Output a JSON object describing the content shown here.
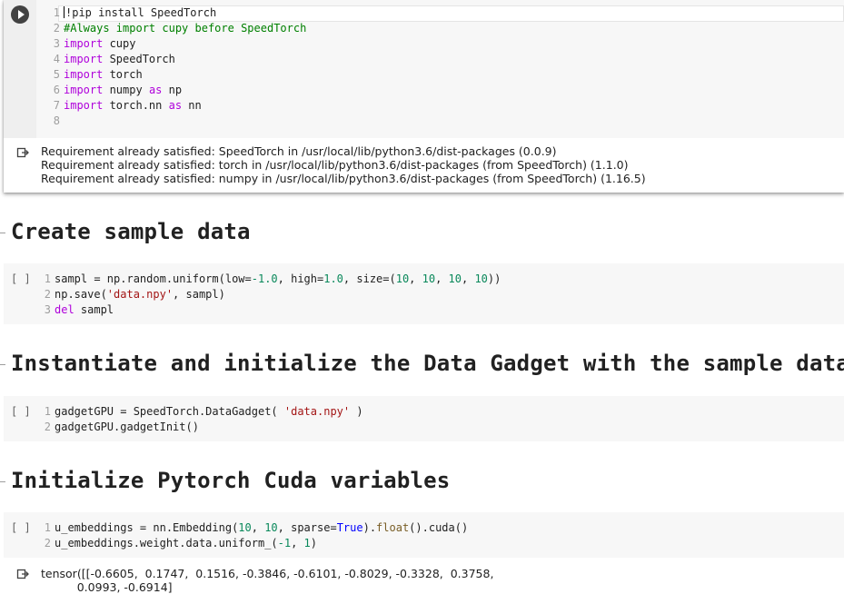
{
  "cell1": {
    "code": [
      {
        "ln": "1",
        "parts": [
          {
            "t": "!pip install SpeedTorch",
            "c": ""
          }
        ]
      },
      {
        "ln": "2",
        "parts": [
          {
            "t": "#Always import cupy before SpeedTorch",
            "c": "cmt"
          }
        ]
      },
      {
        "ln": "3",
        "parts": [
          {
            "t": "import",
            "c": "kw"
          },
          {
            "t": " cupy",
            "c": ""
          }
        ]
      },
      {
        "ln": "4",
        "parts": [
          {
            "t": "import",
            "c": "kw"
          },
          {
            "t": " SpeedTorch",
            "c": ""
          }
        ]
      },
      {
        "ln": "5",
        "parts": [
          {
            "t": "import",
            "c": "kw"
          },
          {
            "t": " torch",
            "c": ""
          }
        ]
      },
      {
        "ln": "6",
        "parts": [
          {
            "t": "import",
            "c": "kw"
          },
          {
            "t": " numpy ",
            "c": ""
          },
          {
            "t": "as",
            "c": "kw"
          },
          {
            "t": " np",
            "c": ""
          }
        ]
      },
      {
        "ln": "7",
        "parts": [
          {
            "t": "import",
            "c": "kw"
          },
          {
            "t": " torch.nn ",
            "c": ""
          },
          {
            "t": "as",
            "c": "kw"
          },
          {
            "t": " nn",
            "c": ""
          }
        ]
      },
      {
        "ln": "8",
        "parts": []
      }
    ],
    "output": [
      "Requirement already satisfied: SpeedTorch in /usr/local/lib/python3.6/dist-packages (0.0.9)",
      "Requirement already satisfied: torch in /usr/local/lib/python3.6/dist-packages (from SpeedTorch) (1.1.0)",
      "Requirement already satisfied: numpy in /usr/local/lib/python3.6/dist-packages (from SpeedTorch) (1.16.5)"
    ]
  },
  "headings": {
    "h1": "Create sample data",
    "h2": "Instantiate and initialize the Data Gadget with the sample data",
    "h3": "Initialize Pytorch Cuda variables"
  },
  "exec_count_label": "[ ]",
  "cell2": {
    "code": [
      {
        "ln": "1",
        "parts": [
          {
            "t": "sampl = np.random.uniform(low=",
            "c": ""
          },
          {
            "t": "-1.0",
            "c": "num"
          },
          {
            "t": ", high=",
            "c": ""
          },
          {
            "t": "1.0",
            "c": "num"
          },
          {
            "t": ", size=(",
            "c": ""
          },
          {
            "t": "10",
            "c": "num"
          },
          {
            "t": ", ",
            "c": ""
          },
          {
            "t": "10",
            "c": "num"
          },
          {
            "t": ", ",
            "c": ""
          },
          {
            "t": "10",
            "c": "num"
          },
          {
            "t": ", ",
            "c": ""
          },
          {
            "t": "10",
            "c": "num"
          },
          {
            "t": "))",
            "c": ""
          }
        ]
      },
      {
        "ln": "2",
        "parts": [
          {
            "t": "np.save(",
            "c": ""
          },
          {
            "t": "'data.npy'",
            "c": "str"
          },
          {
            "t": ", sampl)",
            "c": ""
          }
        ]
      },
      {
        "ln": "3",
        "parts": [
          {
            "t": "del",
            "c": "kw"
          },
          {
            "t": " sampl",
            "c": ""
          }
        ]
      }
    ]
  },
  "cell3": {
    "code": [
      {
        "ln": "1",
        "parts": [
          {
            "t": "gadgetGPU = SpeedTorch.DataGadget( ",
            "c": ""
          },
          {
            "t": "'data.npy'",
            "c": "str"
          },
          {
            "t": " )",
            "c": ""
          }
        ]
      },
      {
        "ln": "2",
        "parts": [
          {
            "t": "gadgetGPU.gadgetInit()",
            "c": ""
          }
        ]
      }
    ]
  },
  "cell4": {
    "code": [
      {
        "ln": "1",
        "parts": [
          {
            "t": "u_embeddings = nn.Embedding(",
            "c": ""
          },
          {
            "t": "10",
            "c": "num"
          },
          {
            "t": ", ",
            "c": ""
          },
          {
            "t": "10",
            "c": "num"
          },
          {
            "t": ", sparse=",
            "c": ""
          },
          {
            "t": "True",
            "c": "bi"
          },
          {
            "t": ").",
            "c": ""
          },
          {
            "t": "float",
            "c": "fn"
          },
          {
            "t": "().cuda()",
            "c": ""
          }
        ]
      },
      {
        "ln": "2",
        "parts": [
          {
            "t": "u_embeddings.weight.data.uniform_(",
            "c": ""
          },
          {
            "t": "-1",
            "c": "num"
          },
          {
            "t": ", ",
            "c": ""
          },
          {
            "t": "1",
            "c": "num"
          },
          {
            "t": ")",
            "c": ""
          }
        ]
      }
    ],
    "output": [
      "tensor([[-0.6605,  0.1747,  0.1516, -0.3846, -0.6101, -0.8029, -0.3328,  0.3758,",
      "          0.0993, -0.6914]"
    ]
  },
  "icons": {
    "run": "play-circle-icon",
    "output": "output-arrow-icon"
  },
  "colors": {
    "keyword": "#af00db",
    "comment": "#008000",
    "number": "#09885a",
    "string": "#a31515",
    "builtin": "#0000ff",
    "cell_bg": "#f7f7f7"
  }
}
